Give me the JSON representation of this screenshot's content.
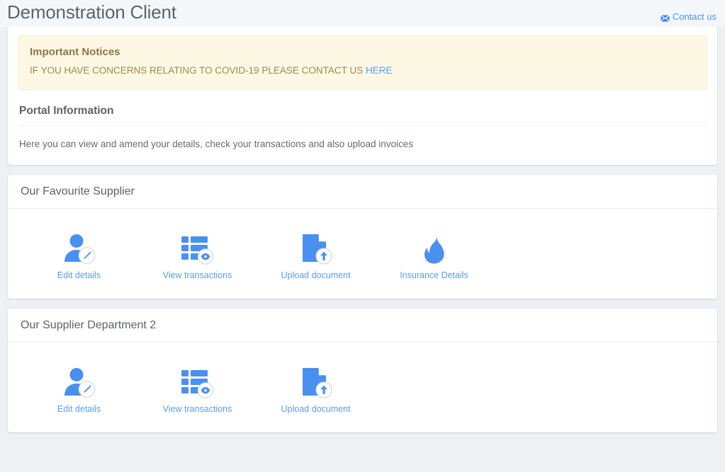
{
  "header": {
    "title": "Demonstration Client",
    "contact_label": "Contact us",
    "contact_icon": "envelope-icon"
  },
  "notice": {
    "title": "Important Notices",
    "text_before": "IF YOU HAVE CONCERNS RELATING TO COVID-19 PLEASE CONTACT US ",
    "link_label": "HERE"
  },
  "portal_info": {
    "title": "Portal Information",
    "text": "Here you can view and amend your details, check your transactions and also upload invoices"
  },
  "suppliers": [
    {
      "title": "Our Favourite Supplier",
      "actions": [
        {
          "label": "Edit details",
          "icon": "user-edit-icon"
        },
        {
          "label": "View transactions",
          "icon": "list-view-icon"
        },
        {
          "label": "Upload document",
          "icon": "document-upload-icon"
        },
        {
          "label": "Insurance Details",
          "icon": "flame-icon"
        }
      ]
    },
    {
      "title": "Our Supplier Department 2",
      "actions": [
        {
          "label": "Edit details",
          "icon": "user-edit-icon"
        },
        {
          "label": "View transactions",
          "icon": "list-view-icon"
        },
        {
          "label": "Upload document",
          "icon": "document-upload-icon"
        }
      ]
    }
  ],
  "colors": {
    "page_background": "#eef1f4",
    "accent_blue": "#4a90f0",
    "link_blue": "#5b9bf5",
    "notice_background": "#fcf8e3",
    "notice_title": "#8a7a42",
    "text_grey": "#5b636b"
  }
}
